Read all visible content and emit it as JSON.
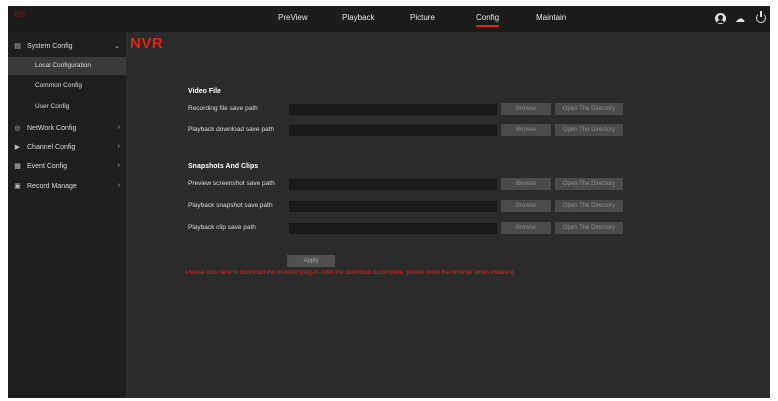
{
  "app": {
    "logo_main": "NVR",
    "logo_sub": "en"
  },
  "nav": {
    "items": [
      {
        "label": "PreView"
      },
      {
        "label": "Playback"
      },
      {
        "label": "Picture"
      },
      {
        "label": "Config",
        "active": true
      },
      {
        "label": "Maintain"
      }
    ]
  },
  "top_icons": [
    "user-avatar-icon",
    "cloud-upload-icon",
    "power-icon"
  ],
  "sidebar": {
    "items": [
      {
        "label": "System Config",
        "icon": "system-config-icon",
        "expanded": true
      },
      {
        "label": "Local Configuration",
        "sub": true,
        "active": true
      },
      {
        "label": "Common Config",
        "sub": true
      },
      {
        "label": "User Config",
        "sub": true
      },
      {
        "label": "NetWork Config",
        "icon": "network-icon"
      },
      {
        "label": "Channel Config",
        "icon": "channel-icon"
      },
      {
        "label": "Event Config",
        "icon": "event-icon"
      },
      {
        "label": "Record Manage",
        "icon": "record-icon"
      }
    ]
  },
  "main": {
    "sections": [
      {
        "title": "Video File",
        "rows": [
          {
            "label": "Recording file save path",
            "value": ""
          },
          {
            "label": "Playback download save path",
            "value": ""
          }
        ]
      },
      {
        "title": "Snapshots And Clips",
        "rows": [
          {
            "label": "Preview screenshot save path",
            "value": ""
          },
          {
            "label": "Playback snapshot save path",
            "value": ""
          },
          {
            "label": "Playback clip save path",
            "value": ""
          }
        ]
      }
    ],
    "browse_label": "Browse",
    "open_dir_label": "Open The Directory",
    "apply_label": "Apply",
    "warning": "Please click here to download the browser plug-in. After the download is complete, please close the browser when installing."
  },
  "colors": {
    "accent": "#e2231a",
    "background": "#2b2b2b",
    "topbar": "#1b1b1b",
    "sidebar": "#1e1e1e"
  }
}
